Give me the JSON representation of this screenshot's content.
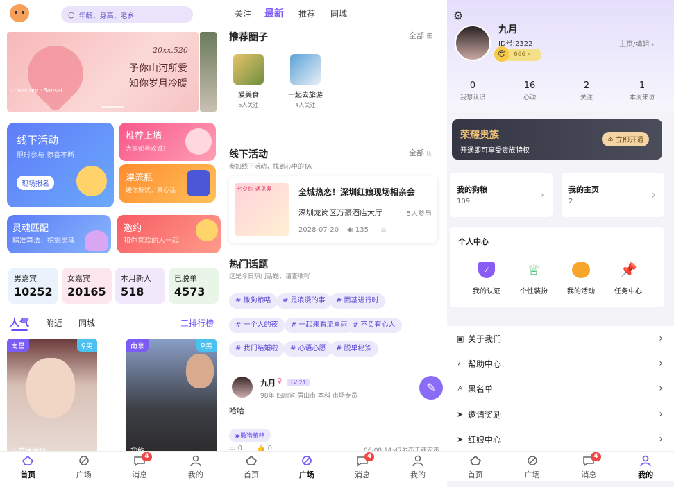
{
  "colors": {
    "accent": "#7b5cf5",
    "pink": "#f7617a",
    "gold": "#f0c27a",
    "badge": "#f04646"
  },
  "home": {
    "search_placeholder": "年龄、身高、老乡",
    "banner": {
      "line1": "20xx.520",
      "line2": "予你山河所爱",
      "line3": "知你岁月冷暖",
      "line4": "Lovestory · Sunset"
    },
    "offline": {
      "title": "线下活动",
      "sub": "限时参与 惊喜不断",
      "btn": "现场报名"
    },
    "recommend": {
      "title": "推荐上墙",
      "sub": "大家都喜欢谁!"
    },
    "bottle": {
      "title": "漂流瓶",
      "sub": "缓你解忧，真心话"
    },
    "soul": {
      "title": "灵魂匹配",
      "sub": "精准算法，挖掘灵魂"
    },
    "invite": {
      "title": "邀约",
      "sub": "和你喜欢的人一起"
    },
    "stats": [
      {
        "label": "男嘉宾",
        "value": "10252"
      },
      {
        "label": "女嘉宾",
        "value": "20165"
      },
      {
        "label": "本月新人",
        "value": "518"
      },
      {
        "label": "已脱单",
        "value": "4573"
      }
    ],
    "tabs": [
      "人气",
      "附近",
      "同城"
    ],
    "rank": "三排行榜",
    "profiles": [
      {
        "city": "南昌",
        "gender": "男",
        "name": "小花妹妹哟"
      },
      {
        "city": "南京",
        "gender": "男",
        "name": "我能"
      }
    ]
  },
  "square": {
    "tabs": [
      "关注",
      "最新",
      "推荐",
      "同城"
    ],
    "circles_title": "推荐圈子",
    "all": "全部",
    "circles": [
      {
        "name": "爱美食",
        "count": "5人关注"
      },
      {
        "name": "一起去旅游",
        "count": "4人关注"
      }
    ],
    "offline_title": "线下活动",
    "offline_sub": "参加线下活动，找到心中的TA",
    "event": {
      "thumb": "七夕约 遇见爱",
      "title": "全城热恋！深圳红娘现场相亲会",
      "place": "深圳龙岗区万豪酒店大厅",
      "count": "5人参与",
      "date": "2028-07-20",
      "views": "135"
    },
    "topics_title": "热门话题",
    "topics_sub": "这是今日热门话题，请查收吖",
    "topics": [
      "# 撒狗粮咯",
      "# 是浪漫的事",
      "# 面基进行时",
      "# 一个人的夜",
      "# 一起来看流星雨",
      "# 不负有心人",
      "# 我们结婚啦",
      "# 心语心愿",
      "# 脱单秘笈"
    ],
    "post": {
      "name": "九月",
      "level": "LV 21",
      "meta": "98年 四川省·眉山市 本科 市场专员",
      "text": "哈哈",
      "tag": "撒狗粮咯",
      "comments": "0",
      "likes": "0",
      "time": "06-08 14:47发布于西安市"
    }
  },
  "mine": {
    "name": "九月",
    "id": "ID号:2322",
    "coins": "666",
    "edit": "主页/编辑",
    "counts": [
      {
        "v": "0",
        "l": "我想认识"
      },
      {
        "v": "16",
        "l": "心动"
      },
      {
        "v": "2",
        "l": "关注"
      },
      {
        "v": "1",
        "l": "本周来访"
      }
    ],
    "vip": {
      "title": "荣耀贵族",
      "sub": "开通即可享受贵族特权",
      "btn": "立即开通"
    },
    "grain": {
      "title": "我的狗粮",
      "v": "109"
    },
    "home": {
      "title": "我的主页",
      "v": "2"
    },
    "center": "个人中心",
    "center_items": [
      "我的认证",
      "个性装扮",
      "我的活动",
      "任务中心"
    ],
    "menu": [
      "关于我们",
      "帮助中心",
      "黑名单",
      "邀请奖励",
      "红娘中心"
    ]
  },
  "tabbar": {
    "items": [
      "首页",
      "广场",
      "消息",
      "我的"
    ],
    "badge": "4"
  }
}
